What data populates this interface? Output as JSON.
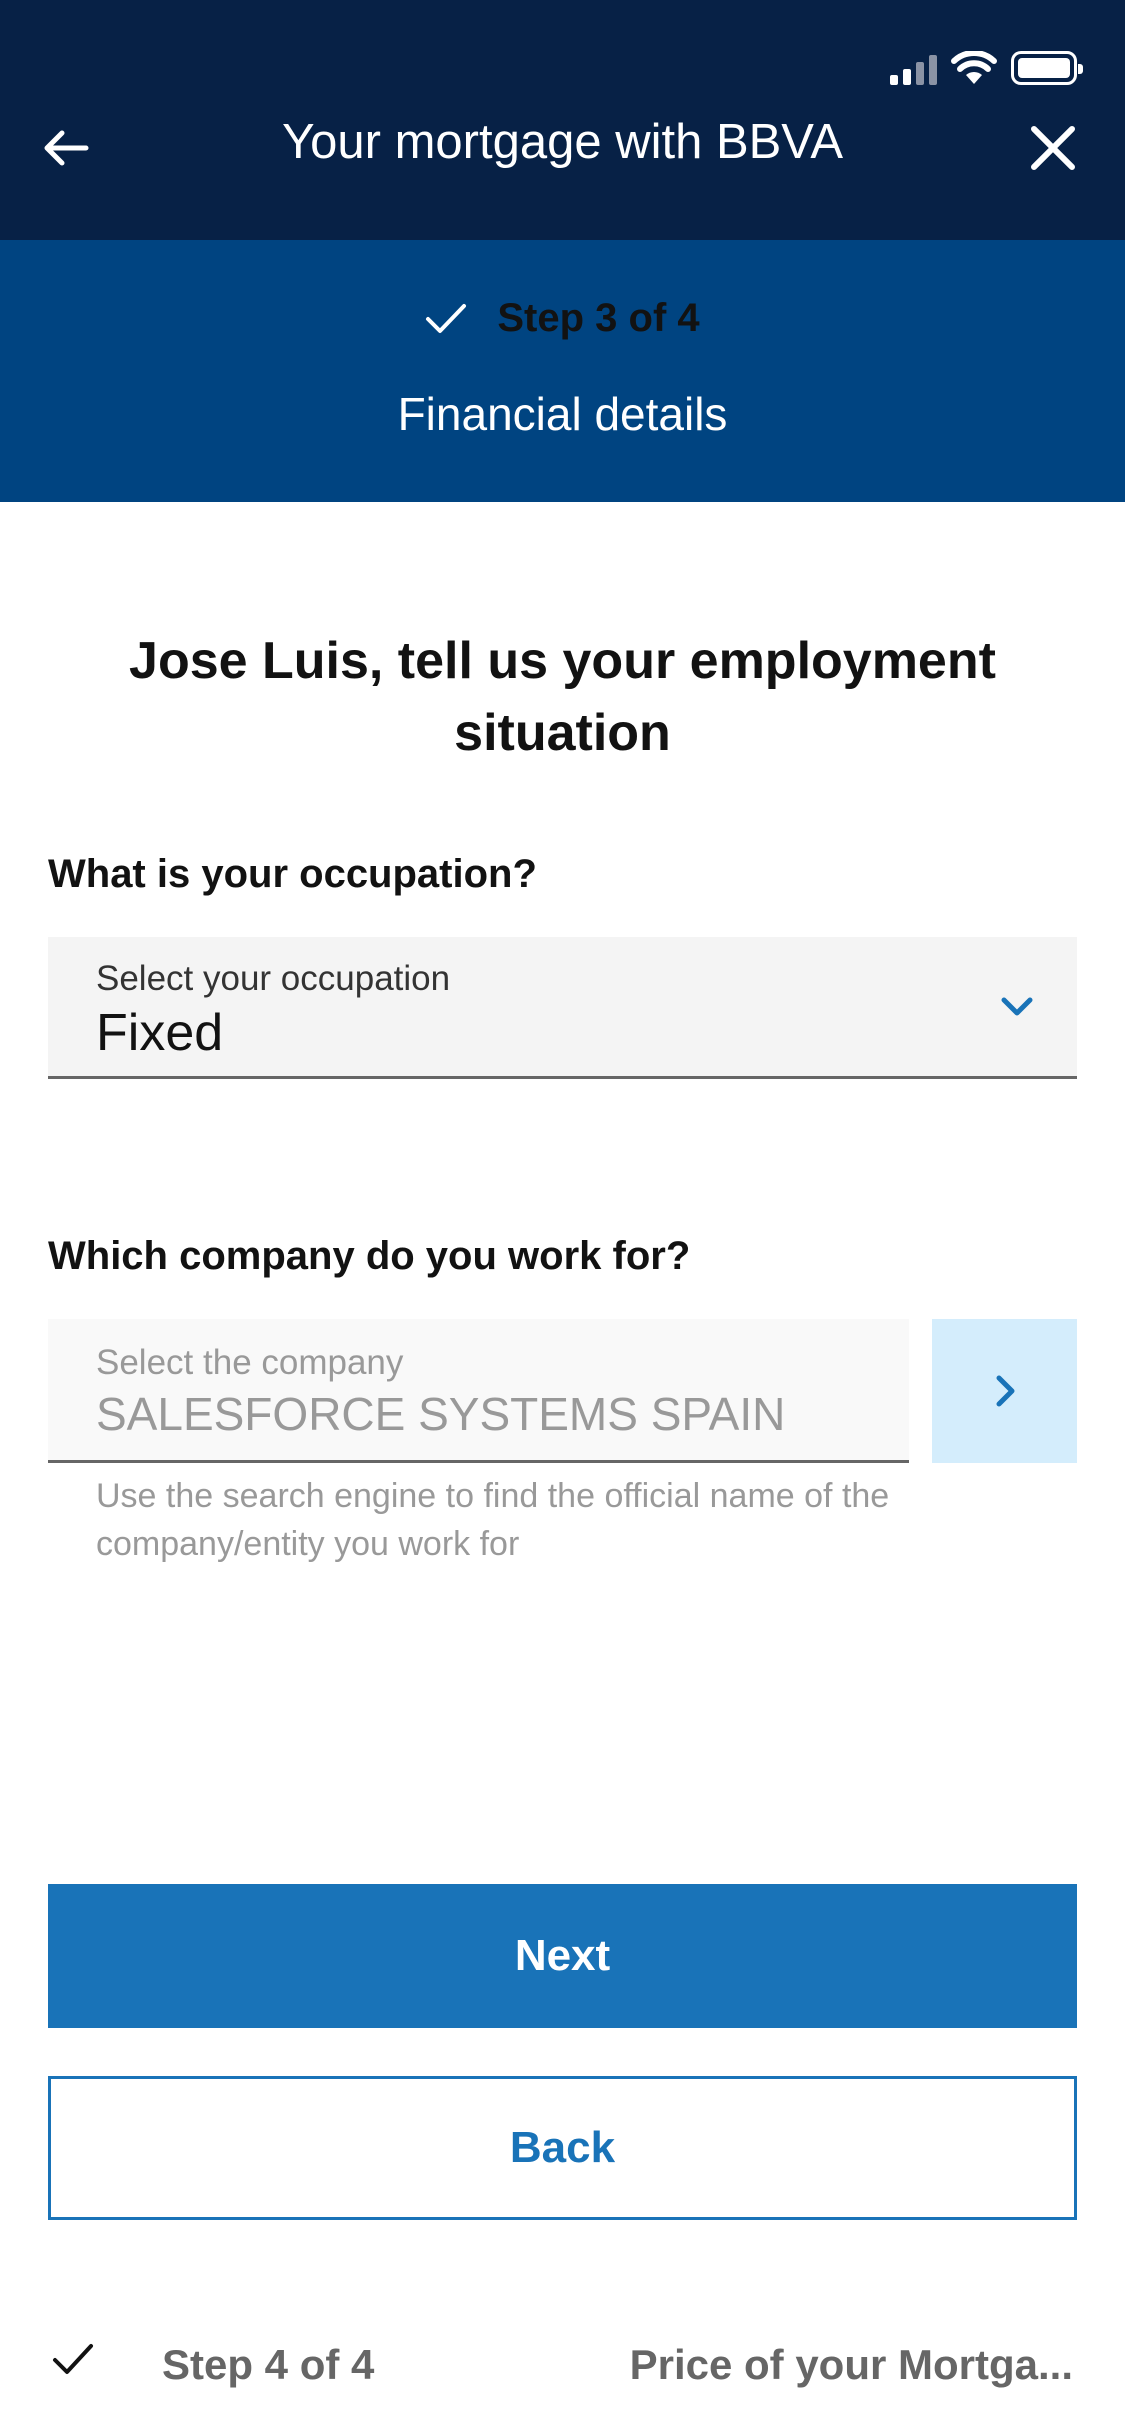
{
  "header": {
    "title": "Your mortgage with BBVA",
    "back_icon": "arrow-left-icon",
    "close_icon": "close-icon"
  },
  "progress": {
    "current_step": "Step 3 of 4",
    "current_step_name": "Financial details",
    "next_step": "Step 4 of 4",
    "next_step_name": "Price of your Mortga..."
  },
  "form": {
    "heading": "Jose Luis, tell us your employment situation",
    "occupation": {
      "question": "What is your occupation?",
      "label": "Select your occupation",
      "value": "Fixed"
    },
    "company": {
      "question": "Which company do you work for?",
      "label": "Select the company",
      "value": "SALESFORCE SYSTEMS SPAIN",
      "helper": "Use the search engine to find the official name of the company/entity you work for"
    }
  },
  "actions": {
    "next_label": "Next",
    "back_label": "Back"
  },
  "colors": {
    "navy": "#072146",
    "step_blue": "#004481",
    "primary": "#1973b8",
    "light_blue": "#d4edfc"
  }
}
